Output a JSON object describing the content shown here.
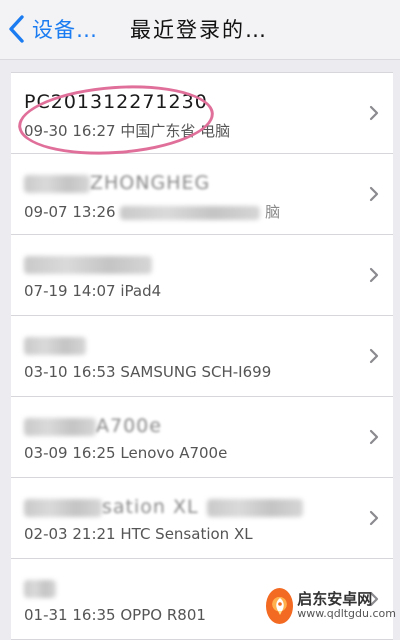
{
  "navbar": {
    "back_label": "设备…",
    "title": "最近登录的…"
  },
  "sessions": [
    {
      "device": "PC201312271230",
      "device_redacted": false,
      "datetime": "09-30  16:27",
      "location": "中国广东省 电脑",
      "location_redacted": false
    },
    {
      "device": "",
      "device_redacted": true,
      "device_visible_fragment": "ZHONGHEG",
      "datetime": "09-07  13:26",
      "location": "",
      "location_redacted": true,
      "location_visible_fragment": "脑"
    },
    {
      "device": "",
      "device_redacted": true,
      "datetime": "07-19  14:07",
      "location": "iPad4",
      "location_redacted": false
    },
    {
      "device": "",
      "device_redacted": true,
      "datetime": "03-10  16:53",
      "location": "SAMSUNG SCH-I699",
      "location_redacted": false
    },
    {
      "device": "",
      "device_redacted": true,
      "device_visible_fragment": "A700e",
      "datetime": "03-09  16:25",
      "location": "Lenovo A700e",
      "location_redacted": false
    },
    {
      "device": "",
      "device_redacted": true,
      "device_visible_fragment": "sation XL",
      "datetime": "02-03  21:21",
      "location": "HTC Sensation XL",
      "location_redacted": false
    },
    {
      "device": "",
      "device_redacted": true,
      "datetime": "01-31  16:35",
      "location": "OPPO R801",
      "location_redacted": false
    }
  ],
  "watermark": {
    "title": "启东安卓网",
    "url": "www.qdltgdu.com"
  },
  "colors": {
    "accent": "#1b7cf2",
    "highlight": "#e0709a"
  },
  "icons": {
    "back": "chevron-left-icon",
    "row": "chevron-right-icon"
  }
}
